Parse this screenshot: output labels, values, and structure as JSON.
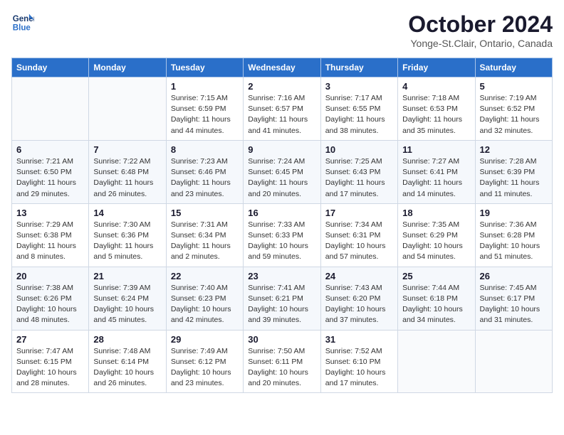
{
  "header": {
    "logo_line1": "General",
    "logo_line2": "Blue",
    "month": "October 2024",
    "location": "Yonge-St.Clair, Ontario, Canada"
  },
  "weekdays": [
    "Sunday",
    "Monday",
    "Tuesday",
    "Wednesday",
    "Thursday",
    "Friday",
    "Saturday"
  ],
  "weeks": [
    [
      {
        "day": "",
        "info": ""
      },
      {
        "day": "",
        "info": ""
      },
      {
        "day": "1",
        "info": "Sunrise: 7:15 AM\nSunset: 6:59 PM\nDaylight: 11 hours and 44 minutes."
      },
      {
        "day": "2",
        "info": "Sunrise: 7:16 AM\nSunset: 6:57 PM\nDaylight: 11 hours and 41 minutes."
      },
      {
        "day": "3",
        "info": "Sunrise: 7:17 AM\nSunset: 6:55 PM\nDaylight: 11 hours and 38 minutes."
      },
      {
        "day": "4",
        "info": "Sunrise: 7:18 AM\nSunset: 6:53 PM\nDaylight: 11 hours and 35 minutes."
      },
      {
        "day": "5",
        "info": "Sunrise: 7:19 AM\nSunset: 6:52 PM\nDaylight: 11 hours and 32 minutes."
      }
    ],
    [
      {
        "day": "6",
        "info": "Sunrise: 7:21 AM\nSunset: 6:50 PM\nDaylight: 11 hours and 29 minutes."
      },
      {
        "day": "7",
        "info": "Sunrise: 7:22 AM\nSunset: 6:48 PM\nDaylight: 11 hours and 26 minutes."
      },
      {
        "day": "8",
        "info": "Sunrise: 7:23 AM\nSunset: 6:46 PM\nDaylight: 11 hours and 23 minutes."
      },
      {
        "day": "9",
        "info": "Sunrise: 7:24 AM\nSunset: 6:45 PM\nDaylight: 11 hours and 20 minutes."
      },
      {
        "day": "10",
        "info": "Sunrise: 7:25 AM\nSunset: 6:43 PM\nDaylight: 11 hours and 17 minutes."
      },
      {
        "day": "11",
        "info": "Sunrise: 7:27 AM\nSunset: 6:41 PM\nDaylight: 11 hours and 14 minutes."
      },
      {
        "day": "12",
        "info": "Sunrise: 7:28 AM\nSunset: 6:39 PM\nDaylight: 11 hours and 11 minutes."
      }
    ],
    [
      {
        "day": "13",
        "info": "Sunrise: 7:29 AM\nSunset: 6:38 PM\nDaylight: 11 hours and 8 minutes."
      },
      {
        "day": "14",
        "info": "Sunrise: 7:30 AM\nSunset: 6:36 PM\nDaylight: 11 hours and 5 minutes."
      },
      {
        "day": "15",
        "info": "Sunrise: 7:31 AM\nSunset: 6:34 PM\nDaylight: 11 hours and 2 minutes."
      },
      {
        "day": "16",
        "info": "Sunrise: 7:33 AM\nSunset: 6:33 PM\nDaylight: 10 hours and 59 minutes."
      },
      {
        "day": "17",
        "info": "Sunrise: 7:34 AM\nSunset: 6:31 PM\nDaylight: 10 hours and 57 minutes."
      },
      {
        "day": "18",
        "info": "Sunrise: 7:35 AM\nSunset: 6:29 PM\nDaylight: 10 hours and 54 minutes."
      },
      {
        "day": "19",
        "info": "Sunrise: 7:36 AM\nSunset: 6:28 PM\nDaylight: 10 hours and 51 minutes."
      }
    ],
    [
      {
        "day": "20",
        "info": "Sunrise: 7:38 AM\nSunset: 6:26 PM\nDaylight: 10 hours and 48 minutes."
      },
      {
        "day": "21",
        "info": "Sunrise: 7:39 AM\nSunset: 6:24 PM\nDaylight: 10 hours and 45 minutes."
      },
      {
        "day": "22",
        "info": "Sunrise: 7:40 AM\nSunset: 6:23 PM\nDaylight: 10 hours and 42 minutes."
      },
      {
        "day": "23",
        "info": "Sunrise: 7:41 AM\nSunset: 6:21 PM\nDaylight: 10 hours and 39 minutes."
      },
      {
        "day": "24",
        "info": "Sunrise: 7:43 AM\nSunset: 6:20 PM\nDaylight: 10 hours and 37 minutes."
      },
      {
        "day": "25",
        "info": "Sunrise: 7:44 AM\nSunset: 6:18 PM\nDaylight: 10 hours and 34 minutes."
      },
      {
        "day": "26",
        "info": "Sunrise: 7:45 AM\nSunset: 6:17 PM\nDaylight: 10 hours and 31 minutes."
      }
    ],
    [
      {
        "day": "27",
        "info": "Sunrise: 7:47 AM\nSunset: 6:15 PM\nDaylight: 10 hours and 28 minutes."
      },
      {
        "day": "28",
        "info": "Sunrise: 7:48 AM\nSunset: 6:14 PM\nDaylight: 10 hours and 26 minutes."
      },
      {
        "day": "29",
        "info": "Sunrise: 7:49 AM\nSunset: 6:12 PM\nDaylight: 10 hours and 23 minutes."
      },
      {
        "day": "30",
        "info": "Sunrise: 7:50 AM\nSunset: 6:11 PM\nDaylight: 10 hours and 20 minutes."
      },
      {
        "day": "31",
        "info": "Sunrise: 7:52 AM\nSunset: 6:10 PM\nDaylight: 10 hours and 17 minutes."
      },
      {
        "day": "",
        "info": ""
      },
      {
        "day": "",
        "info": ""
      }
    ]
  ]
}
